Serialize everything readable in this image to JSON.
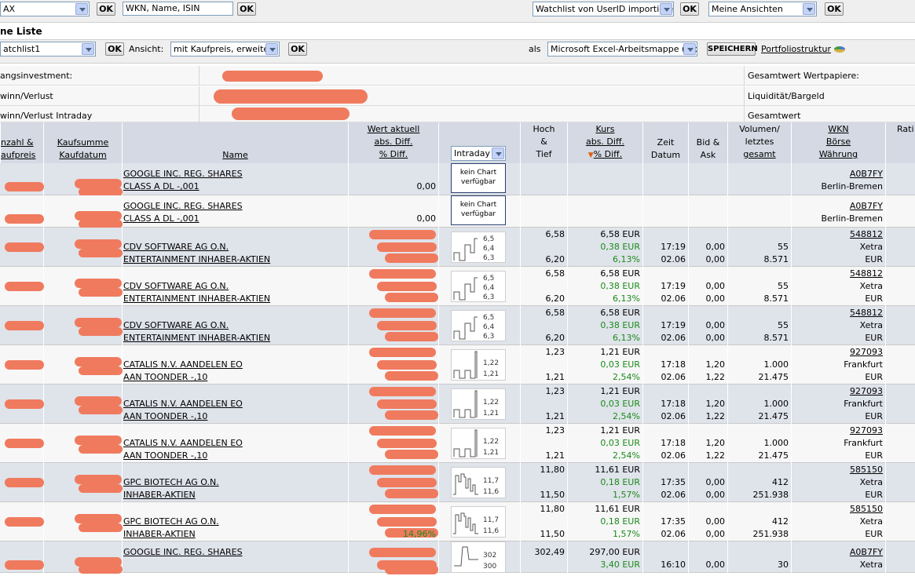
{
  "topbar": {
    "select1_value": "AX",
    "ok": "OK",
    "search_value": "WKN, Name, ISIN",
    "import_value": "Watchlist von UserID importieren",
    "views_value": "Meine Ansichten"
  },
  "title": "ne Liste",
  "toolbar": {
    "watchlist_value": "atchlist1",
    "ok": "OK",
    "view_label": "Ansicht:",
    "view_value": "mit Kaufpreis, erweitert",
    "as_label": "als",
    "format_value": "Microsoft Excel-Arbeitsmappe (*.xls)",
    "save_label": "SPEICHERN",
    "portfolio_link": "Portfoliostruktur"
  },
  "summary": {
    "row1_left": "angsinvestment:",
    "row1_right": "Gesamtwert Wertpapiere:",
    "row2_left": "winn/Verlust",
    "row2_right": "Liquidität/Bargeld",
    "row3_left": "winn/Verlust Intraday",
    "row3_right": "Gesamtwert"
  },
  "headers": {
    "anzahl": [
      "nzahl &",
      "aufpreis"
    ],
    "kaufsumme": [
      "Kaufsumme",
      "Kaufdatum"
    ],
    "name": "Name",
    "wert": [
      "Wert aktuell",
      "abs. Diff.",
      "% Diff."
    ],
    "intraday_value": "Intraday",
    "hoch": [
      "Hoch",
      "&",
      "Tief"
    ],
    "kurs": [
      "Kurs",
      "abs. Diff.",
      "% Diff."
    ],
    "zeit": [
      "Zeit",
      "Datum"
    ],
    "bid": [
      "Bid &",
      "Ask"
    ],
    "volumen": [
      "Volumen/",
      "letztes",
      "gesamt"
    ],
    "wkn": [
      "WKN",
      "Börse",
      "Währung"
    ],
    "rati": "Rati"
  },
  "rows": [
    {
      "name1": "GOOGLE INC. REG. SHARES",
      "name2": "CLASS A DL -,001",
      "wert3": "0,00",
      "chart": "none",
      "hoch": "",
      "tief": "",
      "kurs": "",
      "diff": "",
      "pct": "",
      "zeit": "",
      "datum": "",
      "bid": "",
      "ask": "",
      "vol1": "",
      "vol2": "",
      "wkn": "A0B7FY",
      "boerse": "Berlin-Bremen",
      "waehrung": ""
    },
    {
      "name1": "GOOGLE INC. REG. SHARES",
      "name2": "CLASS A DL -,001",
      "wert3": "0,00",
      "chart": "none",
      "hoch": "",
      "tief": "",
      "kurs": "",
      "diff": "",
      "pct": "",
      "zeit": "",
      "datum": "",
      "bid": "",
      "ask": "",
      "vol1": "",
      "vol2": "",
      "wkn": "A0B7FY",
      "boerse": "Berlin-Bremen",
      "waehrung": ""
    },
    {
      "name1": "CDV SOFTWARE AG O.N.",
      "name2": "ENTERTAINMENT INHABER-AKTIEN",
      "wert3": "",
      "chart": "cdv",
      "hoch": "6,58",
      "tief": "6,20",
      "kurs": "6,58 EUR",
      "diff": "0,38 EUR",
      "pct": "6,13%",
      "zeit": "17:19",
      "datum": "02.06",
      "bid": "0,00",
      "ask": "0,00",
      "vol1": "55",
      "vol2": "8.571",
      "wkn": "548812",
      "boerse": "Xetra",
      "waehrung": "EUR"
    },
    {
      "name1": "CDV SOFTWARE AG O.N.",
      "name2": "ENTERTAINMENT INHABER-AKTIEN",
      "wert3": "",
      "chart": "cdv",
      "hoch": "6,58",
      "tief": "6,20",
      "kurs": "6,58 EUR",
      "diff": "0,38 EUR",
      "pct": "6,13%",
      "zeit": "17:19",
      "datum": "02.06",
      "bid": "0,00",
      "ask": "0,00",
      "vol1": "55",
      "vol2": "8.571",
      "wkn": "548812",
      "boerse": "Xetra",
      "waehrung": "EUR"
    },
    {
      "name1": "CDV SOFTWARE AG O.N.",
      "name2": "ENTERTAINMENT INHABER-AKTIEN",
      "wert3": "",
      "chart": "cdv",
      "hoch": "6,58",
      "tief": "6,20",
      "kurs": "6,58 EUR",
      "diff": "0,38 EUR",
      "pct": "6,13%",
      "zeit": "17:19",
      "datum": "02.06",
      "bid": "0,00",
      "ask": "0,00",
      "vol1": "55",
      "vol2": "8.571",
      "wkn": "548812",
      "boerse": "Xetra",
      "waehrung": "EUR"
    },
    {
      "name1": "CATALIS N.V. AANDELEN EO",
      "name2": "AAN TOONDER -,10",
      "wert3": "",
      "chart": "cat",
      "hoch": "1,23",
      "tief": "1,21",
      "kurs": "1,21 EUR",
      "diff": "0,03 EUR",
      "pct": "2,54%",
      "zeit": "17:18",
      "datum": "02.06",
      "bid": "1,20",
      "ask": "1,22",
      "vol1": "1.000",
      "vol2": "21.475",
      "wkn": "927093",
      "boerse": "Frankfurt",
      "waehrung": "EUR"
    },
    {
      "name1": "CATALIS N.V. AANDELEN EO",
      "name2": "AAN TOONDER -,10",
      "wert3": "",
      "chart": "cat",
      "hoch": "1,23",
      "tief": "1,21",
      "kurs": "1,21 EUR",
      "diff": "0,03 EUR",
      "pct": "2,54%",
      "zeit": "17:18",
      "datum": "02.06",
      "bid": "1,20",
      "ask": "1,22",
      "vol1": "1.000",
      "vol2": "21.475",
      "wkn": "927093",
      "boerse": "Frankfurt",
      "waehrung": "EUR"
    },
    {
      "name1": "CATALIS N.V. AANDELEN EO",
      "name2": "AAN TOONDER -,10",
      "wert3": "",
      "chart": "cat",
      "hoch": "1,23",
      "tief": "1,21",
      "kurs": "1,21 EUR",
      "diff": "0,03 EUR",
      "pct": "2,54%",
      "zeit": "17:18",
      "datum": "02.06",
      "bid": "1,20",
      "ask": "1,22",
      "vol1": "1.000",
      "vol2": "21.475",
      "wkn": "927093",
      "boerse": "Frankfurt",
      "waehrung": "EUR"
    },
    {
      "name1": "GPC BIOTECH AG O.N.",
      "name2": "INHABER-AKTIEN",
      "wert3": "",
      "chart": "gpc",
      "hoch": "11,80",
      "tief": "11,50",
      "kurs": "11,61 EUR",
      "diff": "0,18 EUR",
      "pct": "1,57%",
      "zeit": "17:35",
      "datum": "02.06",
      "bid": "0,00",
      "ask": "0,00",
      "vol1": "412",
      "vol2": "251.938",
      "wkn": "585150",
      "boerse": "Xetra",
      "waehrung": "EUR"
    },
    {
      "name1": "GPC BIOTECH AG O.N.",
      "name2": "INHABER-AKTIEN",
      "wert3": "14,96%",
      "chart": "gpc",
      "hoch": "11,80",
      "tief": "11,50",
      "kurs": "11,61 EUR",
      "diff": "0,18 EUR",
      "pct": "1,57%",
      "zeit": "17:35",
      "datum": "02.06",
      "bid": "0,00",
      "ask": "0,00",
      "vol1": "412",
      "vol2": "251.938",
      "wkn": "585150",
      "boerse": "Xetra",
      "waehrung": "EUR"
    },
    {
      "name1": "GOOGLE INC. REG. SHARES",
      "name2": "",
      "wert3": "",
      "chart": "goog",
      "hoch": "302,49",
      "tief": "",
      "kurs": "297,00 EUR",
      "diff": "3,40 EUR",
      "pct": "",
      "zeit": "16:10",
      "datum": "",
      "bid": "0,00",
      "ask": "",
      "vol1": "30",
      "vol2": "",
      "wkn": "A0B7FY",
      "boerse": "Xetra",
      "waehrung": ""
    }
  ],
  "charts": {
    "none": {
      "text1": "kein Chart",
      "text2": "verfügbar"
    },
    "cdv": {
      "labels": [
        "6,5",
        "6,4",
        "6,3"
      ]
    },
    "cat": {
      "labels": [
        "1,22",
        "1,21"
      ]
    },
    "gpc": {
      "labels": [
        "11,7",
        "11,6"
      ]
    },
    "goog": {
      "labels": [
        "302",
        "300"
      ]
    }
  }
}
